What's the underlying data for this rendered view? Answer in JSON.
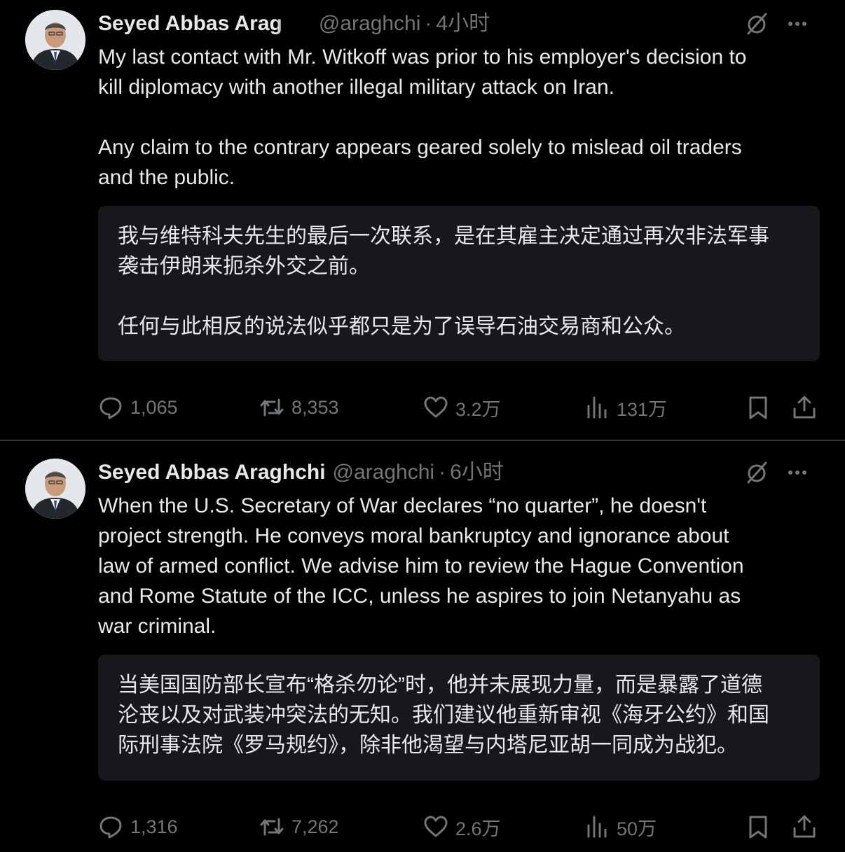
{
  "tweets": [
    {
      "author": "Seyed Abbas Arag",
      "handle": "@araghchi",
      "separator": "·",
      "time": "4小时",
      "text": "My last contact with Mr. Witkoff was prior to his employer's decision to\nkill diplomacy with another illegal military attack on Iran.\n\nAny claim to the contrary appears geared solely to mislead oil traders\nand the public.",
      "translation": "我与维特科夫先生的最后一次联系，是在其雇主决定通过再次非法军事\n袭击伊朗来扼杀外交之前。\n\n任何与此相反的说法似乎都只是为了误导石油交易商和公众。",
      "replies": "1,065",
      "reposts": "8,353",
      "likes": "3.2万",
      "views": "131万"
    },
    {
      "author": "Seyed Abbas Araghchi",
      "handle": "@araghchi",
      "separator": "·",
      "time": "6小时",
      "text": "When the U.S. Secretary of War declares “no quarter”, he doesn't\nproject strength. He conveys moral bankruptcy and ignorance about\nlaw of armed conflict. We advise him to review the Hague Convention\nand Rome Statute of the ICC, unless he aspires to join Netanyahu as\nwar criminal.",
      "translation": "当美国国防部长宣布“格杀勿论”时，他并未展现力量，而是暴露了道德\n沦丧以及对武装冲突法的无知。我们建议他重新审视《海牙公约》和国\n际刑事法院《罗马规约》，除非他渴望与内塔尼亚胡一同成为战犯。",
      "replies": "1,316",
      "reposts": "7,262",
      "likes": "2.6万",
      "views": "50万"
    }
  ],
  "icons": {
    "reply": "reply-icon",
    "repost": "repost-icon",
    "like": "heart-icon",
    "views": "views-icon",
    "bookmark": "bookmark-icon",
    "share": "share-icon",
    "grok": "grok-icon",
    "more": "more-icon"
  },
  "colors": {
    "background": "#000000",
    "text": "#e7e9ea",
    "muted": "#71767b",
    "translation_bg": "#16181c",
    "divider": "#2f3336"
  }
}
